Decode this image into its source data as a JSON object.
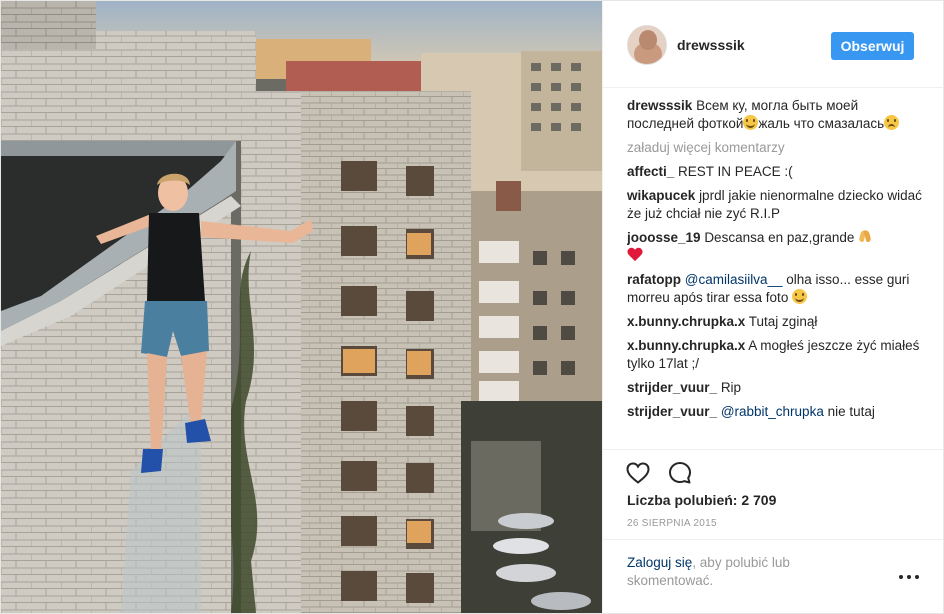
{
  "post": {
    "username": "drewsssik",
    "follow_label": "Obserwuj",
    "caption": {
      "user": "drewsssik",
      "text_part1": "Всем ку, могла быть моей последней фоткой",
      "text_part2": "жаль что смазалась"
    },
    "load_more": "załaduj więcej komentarzy",
    "comments": [
      {
        "user": "affecti_",
        "text": "REST IN PEACE :("
      },
      {
        "user": "wikapucek",
        "text": "jprdl jakie nienormalne dziecko widać że już chciał nie zyć R.I.P"
      },
      {
        "user": "jooosse_19",
        "text": "Descansa en paz,grande"
      },
      {
        "user": "rafatopp",
        "mention": "@camilasiilva__",
        "text": "olha isso... esse guri morreu após tirar essa foto"
      },
      {
        "user": "x.bunny.chrupka.x",
        "text": "Tutaj zginął"
      },
      {
        "user": "x.bunny.chrupka.x",
        "text": "A mogłeś jeszcze żyć miałeś tylko 17lat ;/"
      },
      {
        "user": "strijder_vuur_",
        "text": "Rip"
      },
      {
        "user": "strijder_vuur_",
        "mention": "@rabbit_chrupka",
        "text": "nie tutaj"
      }
    ],
    "likes_label": "Liczba polubień: 2 709",
    "date": "26 SIERPNIA 2015",
    "login_link": "Zaloguj się",
    "login_rest": ", aby polubić lub skomentować.",
    "icons": {
      "like": "heart-outline-icon",
      "comment": "speech-bubble-icon",
      "more": "more-dots-icon"
    },
    "colors": {
      "accent": "#3897f0",
      "link": "#003569",
      "muted": "#999999",
      "text": "#262626"
    }
  }
}
